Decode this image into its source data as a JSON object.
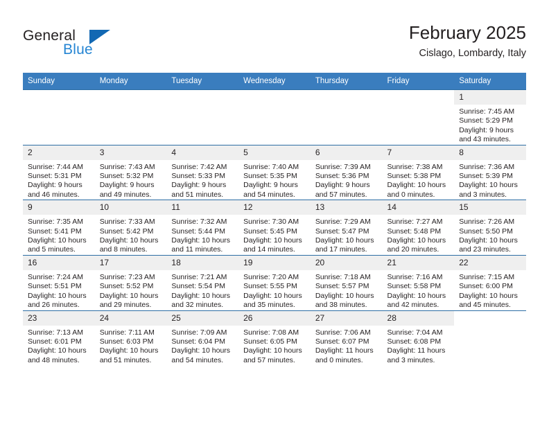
{
  "brand": {
    "name_part1": "General",
    "name_part2": "Blue",
    "triangle_color": "#1268b3",
    "blue_color": "#2585d3"
  },
  "header": {
    "title": "February 2025",
    "subtitle": "Cislago, Lombardy, Italy"
  },
  "colors": {
    "header_bar": "#3a7dbe",
    "row_border": "#2d6da4",
    "daynum_band": "#efefef",
    "text": "#231f20"
  },
  "weekdays": [
    "Sunday",
    "Monday",
    "Tuesday",
    "Wednesday",
    "Thursday",
    "Friday",
    "Saturday"
  ],
  "weeks": [
    [
      {
        "day": "",
        "blank": true
      },
      {
        "day": "",
        "blank": true
      },
      {
        "day": "",
        "blank": true
      },
      {
        "day": "",
        "blank": true
      },
      {
        "day": "",
        "blank": true
      },
      {
        "day": "",
        "blank": true
      },
      {
        "day": "1",
        "sunrise": "Sunrise: 7:45 AM",
        "sunset": "Sunset: 5:29 PM",
        "daylight1": "Daylight: 9 hours",
        "daylight2": "and 43 minutes."
      }
    ],
    [
      {
        "day": "2",
        "sunrise": "Sunrise: 7:44 AM",
        "sunset": "Sunset: 5:31 PM",
        "daylight1": "Daylight: 9 hours",
        "daylight2": "and 46 minutes."
      },
      {
        "day": "3",
        "sunrise": "Sunrise: 7:43 AM",
        "sunset": "Sunset: 5:32 PM",
        "daylight1": "Daylight: 9 hours",
        "daylight2": "and 49 minutes."
      },
      {
        "day": "4",
        "sunrise": "Sunrise: 7:42 AM",
        "sunset": "Sunset: 5:33 PM",
        "daylight1": "Daylight: 9 hours",
        "daylight2": "and 51 minutes."
      },
      {
        "day": "5",
        "sunrise": "Sunrise: 7:40 AM",
        "sunset": "Sunset: 5:35 PM",
        "daylight1": "Daylight: 9 hours",
        "daylight2": "and 54 minutes."
      },
      {
        "day": "6",
        "sunrise": "Sunrise: 7:39 AM",
        "sunset": "Sunset: 5:36 PM",
        "daylight1": "Daylight: 9 hours",
        "daylight2": "and 57 minutes."
      },
      {
        "day": "7",
        "sunrise": "Sunrise: 7:38 AM",
        "sunset": "Sunset: 5:38 PM",
        "daylight1": "Daylight: 10 hours",
        "daylight2": "and 0 minutes."
      },
      {
        "day": "8",
        "sunrise": "Sunrise: 7:36 AM",
        "sunset": "Sunset: 5:39 PM",
        "daylight1": "Daylight: 10 hours",
        "daylight2": "and 3 minutes."
      }
    ],
    [
      {
        "day": "9",
        "sunrise": "Sunrise: 7:35 AM",
        "sunset": "Sunset: 5:41 PM",
        "daylight1": "Daylight: 10 hours",
        "daylight2": "and 5 minutes."
      },
      {
        "day": "10",
        "sunrise": "Sunrise: 7:33 AM",
        "sunset": "Sunset: 5:42 PM",
        "daylight1": "Daylight: 10 hours",
        "daylight2": "and 8 minutes."
      },
      {
        "day": "11",
        "sunrise": "Sunrise: 7:32 AM",
        "sunset": "Sunset: 5:44 PM",
        "daylight1": "Daylight: 10 hours",
        "daylight2": "and 11 minutes."
      },
      {
        "day": "12",
        "sunrise": "Sunrise: 7:30 AM",
        "sunset": "Sunset: 5:45 PM",
        "daylight1": "Daylight: 10 hours",
        "daylight2": "and 14 minutes."
      },
      {
        "day": "13",
        "sunrise": "Sunrise: 7:29 AM",
        "sunset": "Sunset: 5:47 PM",
        "daylight1": "Daylight: 10 hours",
        "daylight2": "and 17 minutes."
      },
      {
        "day": "14",
        "sunrise": "Sunrise: 7:27 AM",
        "sunset": "Sunset: 5:48 PM",
        "daylight1": "Daylight: 10 hours",
        "daylight2": "and 20 minutes."
      },
      {
        "day": "15",
        "sunrise": "Sunrise: 7:26 AM",
        "sunset": "Sunset: 5:50 PM",
        "daylight1": "Daylight: 10 hours",
        "daylight2": "and 23 minutes."
      }
    ],
    [
      {
        "day": "16",
        "sunrise": "Sunrise: 7:24 AM",
        "sunset": "Sunset: 5:51 PM",
        "daylight1": "Daylight: 10 hours",
        "daylight2": "and 26 minutes."
      },
      {
        "day": "17",
        "sunrise": "Sunrise: 7:23 AM",
        "sunset": "Sunset: 5:52 PM",
        "daylight1": "Daylight: 10 hours",
        "daylight2": "and 29 minutes."
      },
      {
        "day": "18",
        "sunrise": "Sunrise: 7:21 AM",
        "sunset": "Sunset: 5:54 PM",
        "daylight1": "Daylight: 10 hours",
        "daylight2": "and 32 minutes."
      },
      {
        "day": "19",
        "sunrise": "Sunrise: 7:20 AM",
        "sunset": "Sunset: 5:55 PM",
        "daylight1": "Daylight: 10 hours",
        "daylight2": "and 35 minutes."
      },
      {
        "day": "20",
        "sunrise": "Sunrise: 7:18 AM",
        "sunset": "Sunset: 5:57 PM",
        "daylight1": "Daylight: 10 hours",
        "daylight2": "and 38 minutes."
      },
      {
        "day": "21",
        "sunrise": "Sunrise: 7:16 AM",
        "sunset": "Sunset: 5:58 PM",
        "daylight1": "Daylight: 10 hours",
        "daylight2": "and 42 minutes."
      },
      {
        "day": "22",
        "sunrise": "Sunrise: 7:15 AM",
        "sunset": "Sunset: 6:00 PM",
        "daylight1": "Daylight: 10 hours",
        "daylight2": "and 45 minutes."
      }
    ],
    [
      {
        "day": "23",
        "sunrise": "Sunrise: 7:13 AM",
        "sunset": "Sunset: 6:01 PM",
        "daylight1": "Daylight: 10 hours",
        "daylight2": "and 48 minutes."
      },
      {
        "day": "24",
        "sunrise": "Sunrise: 7:11 AM",
        "sunset": "Sunset: 6:03 PM",
        "daylight1": "Daylight: 10 hours",
        "daylight2": "and 51 minutes."
      },
      {
        "day": "25",
        "sunrise": "Sunrise: 7:09 AM",
        "sunset": "Sunset: 6:04 PM",
        "daylight1": "Daylight: 10 hours",
        "daylight2": "and 54 minutes."
      },
      {
        "day": "26",
        "sunrise": "Sunrise: 7:08 AM",
        "sunset": "Sunset: 6:05 PM",
        "daylight1": "Daylight: 10 hours",
        "daylight2": "and 57 minutes."
      },
      {
        "day": "27",
        "sunrise": "Sunrise: 7:06 AM",
        "sunset": "Sunset: 6:07 PM",
        "daylight1": "Daylight: 11 hours",
        "daylight2": "and 0 minutes."
      },
      {
        "day": "28",
        "sunrise": "Sunrise: 7:04 AM",
        "sunset": "Sunset: 6:08 PM",
        "daylight1": "Daylight: 11 hours",
        "daylight2": "and 3 minutes."
      },
      {
        "day": "",
        "blank": true
      }
    ]
  ]
}
